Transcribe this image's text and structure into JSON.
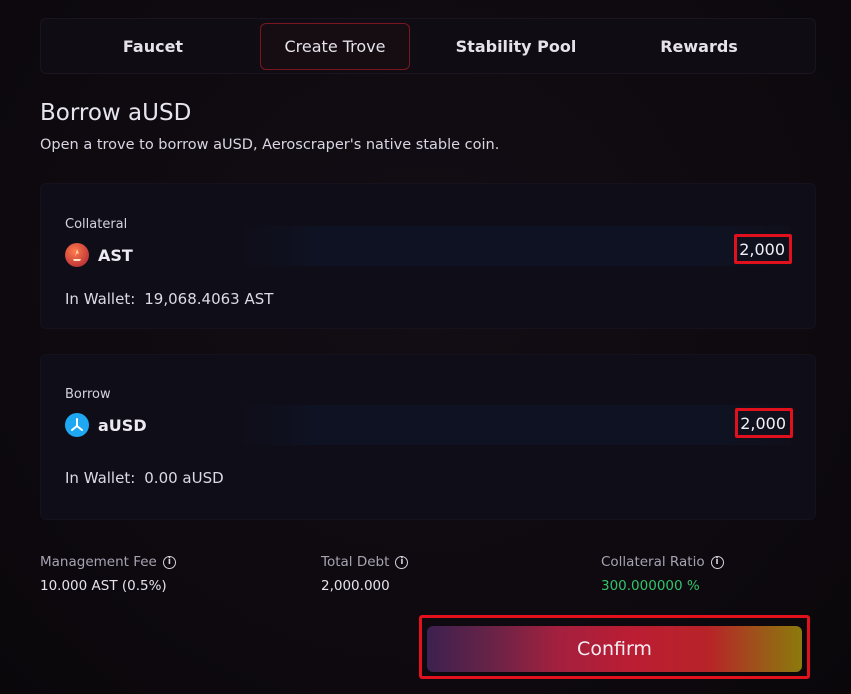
{
  "tabs": [
    {
      "label": "Faucet",
      "active": false
    },
    {
      "label": "Create Trove",
      "active": true
    },
    {
      "label": "Stability Pool",
      "active": false
    },
    {
      "label": "Rewards",
      "active": false
    }
  ],
  "header": {
    "title": "Borrow aUSD",
    "subtitle": "Open a trove to borrow aUSD, Aeroscraper's native stable coin."
  },
  "collateral": {
    "label": "Collateral",
    "token": "AST",
    "token_icon": "ast-token-icon",
    "amount": "2,000",
    "wallet_label": "In Wallet:",
    "wallet_value": "19,068.4063 AST"
  },
  "borrow": {
    "label": "Borrow",
    "token": "aUSD",
    "token_icon": "ausd-token-icon",
    "amount": "2,000",
    "wallet_label": "In Wallet:",
    "wallet_value": "0.00 aUSD"
  },
  "stats": {
    "management_fee": {
      "label": "Management Fee",
      "value": "10.000 AST (0.5%)"
    },
    "total_debt": {
      "label": "Total Debt",
      "value": "2,000.000"
    },
    "collateral_ratio": {
      "label": "Collateral Ratio",
      "value": "300.000000 %"
    }
  },
  "confirm_label": "Confirm",
  "colors": {
    "accent_red": "#e3111c",
    "ratio_green": "#32c36c",
    "background": "#0e0a0f"
  }
}
